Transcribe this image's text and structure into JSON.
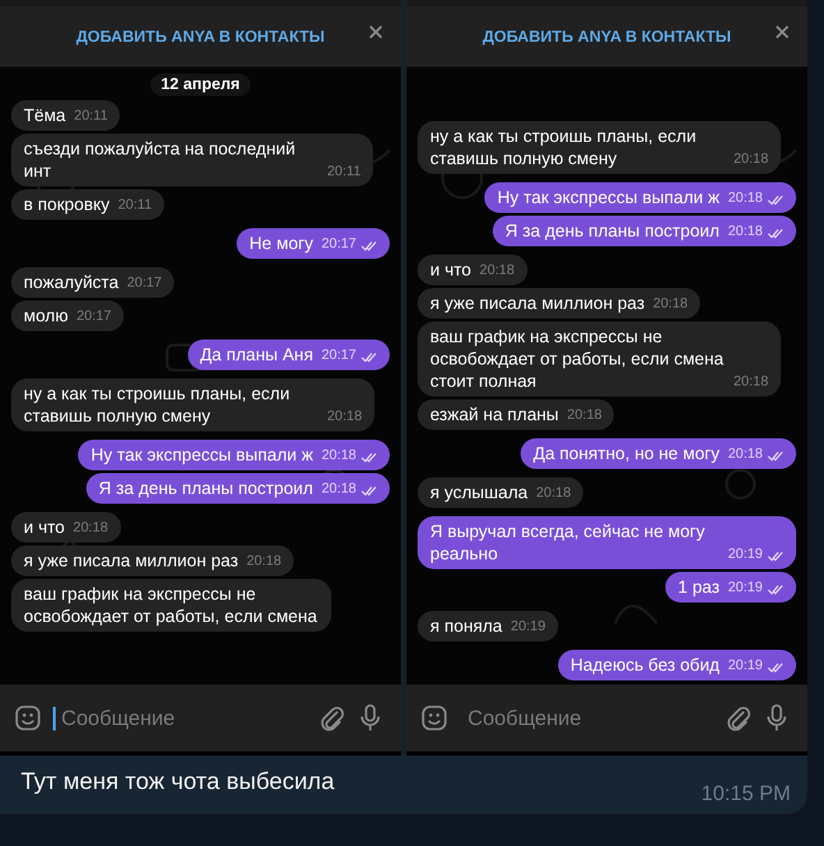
{
  "screenshots": [
    {
      "banner": "ДОБАВИТЬ ANYA В КОНТАКТЫ",
      "date": "12 апреля",
      "messages": [
        {
          "kind": "in",
          "text": "Тёма",
          "time": "20:11"
        },
        {
          "kind": "in",
          "text": "съезди пожалуйста на последний инт",
          "time": "20:11"
        },
        {
          "kind": "in",
          "text": "в покровку",
          "time": "20:11"
        },
        {
          "kind": "out",
          "text": "Не могу",
          "time": "20:17",
          "read": true
        },
        {
          "kind": "in",
          "text": "пожалуйста",
          "time": "20:17"
        },
        {
          "kind": "in",
          "text": "молю",
          "time": "20:17"
        },
        {
          "kind": "out",
          "text": "Да планы Аня",
          "time": "20:17",
          "read": true
        },
        {
          "kind": "in",
          "text": "ну а как ты строишь планы, если ставишь полную смену",
          "time": "20:18"
        },
        {
          "kind": "out",
          "text": "Ну так экспрессы выпали ж",
          "time": "20:18",
          "read": true
        },
        {
          "kind": "out",
          "text": "Я за день планы построил",
          "time": "20:18",
          "read": true
        },
        {
          "kind": "in",
          "text": "и что",
          "time": "20:18"
        },
        {
          "kind": "in",
          "text": "я уже писала миллион раз",
          "time": "20:18"
        },
        {
          "kind": "in",
          "text": "ваш график на экспрессы не освобождает от работы, если смена"
        }
      ],
      "composer": {
        "placeholder": "Сообщение",
        "focused": true
      }
    },
    {
      "banner": "ДОБАВИТЬ ANYA В КОНТАКТЫ",
      "messages": [
        {
          "kind": "in",
          "text": "ну а как ты строишь планы, если ставишь полную смену",
          "time": "20:18"
        },
        {
          "kind": "out",
          "text": "Ну так экспрессы выпали ж",
          "time": "20:18",
          "read": true
        },
        {
          "kind": "out",
          "text": "Я за день планы построил",
          "time": "20:18",
          "read": true
        },
        {
          "kind": "in",
          "text": "и что",
          "time": "20:18"
        },
        {
          "kind": "in",
          "text": "я уже писала миллион раз",
          "time": "20:18"
        },
        {
          "kind": "in",
          "text": "ваш график на экспрессы не освобождает от работы, если смена стоит полная",
          "time": "20:18"
        },
        {
          "kind": "in",
          "text": "езжай на планы",
          "time": "20:18"
        },
        {
          "kind": "out",
          "text": "Да понятно, но не могу",
          "time": "20:18",
          "read": true
        },
        {
          "kind": "in",
          "text": "я услышала",
          "time": "20:18"
        },
        {
          "kind": "out",
          "text": "Я выручал всегда, сейчас не могу реально",
          "time": "20:19",
          "read": true
        },
        {
          "kind": "out",
          "text": "1 раз",
          "time": "20:19",
          "read": true
        },
        {
          "kind": "in",
          "text": "я поняла",
          "time": "20:19"
        },
        {
          "kind": "out",
          "text": "Надеюсь без обид",
          "time": "20:19",
          "read": true
        }
      ],
      "composer": {
        "placeholder": "Сообщение",
        "focused": false
      }
    }
  ],
  "caption": {
    "text": "Тут меня тож чота выбесила",
    "time": "10:15 PM"
  }
}
